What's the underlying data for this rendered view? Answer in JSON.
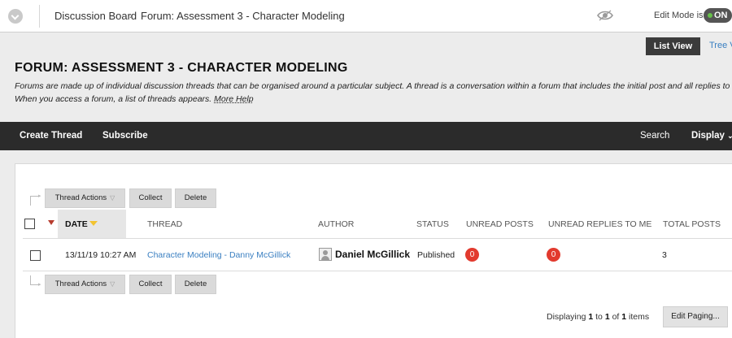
{
  "breadcrumb": {
    "items": [
      "Discussion Board",
      "Forum: Assessment 3 - Character Modeling"
    ],
    "separator": "›"
  },
  "header": {
    "edit_mode_label": "Edit Mode is:",
    "edit_mode_value": "ON"
  },
  "view_tabs": [
    "List View",
    "Tree V"
  ],
  "forum": {
    "title": "FORUM: ASSESSMENT 3 - CHARACTER MODELING",
    "description_line1": "Forums are made up of individual discussion threads that can be organised around a particular subject. A thread is a conversation within a forum that includes the initial post and all replies to it.",
    "description_line2": "When you access a forum, a list of threads appears.",
    "more_help": "More Help"
  },
  "action_bar": {
    "create_thread": "Create Thread",
    "subscribe": "Subscribe",
    "search": "Search",
    "display": "Display"
  },
  "toolbar": {
    "thread_actions": "Thread Actions",
    "collect": "Collect",
    "delete": "Delete"
  },
  "table": {
    "columns": [
      "DATE",
      "THREAD",
      "AUTHOR",
      "STATUS",
      "UNREAD POSTS",
      "UNREAD REPLIES TO ME",
      "TOTAL POSTS"
    ],
    "rows": [
      {
        "date": "13/11/19 10:27 AM",
        "thread": "Character Modeling - Danny McGillick",
        "author": "Daniel McGillick",
        "status": "Published",
        "unread_posts": "0",
        "unread_replies": "0",
        "total_posts": "3"
      }
    ]
  },
  "paging": {
    "prefix": "Displaying",
    "from": "1",
    "to_word": "to",
    "to": "1",
    "of_word": "of",
    "total": "1",
    "suffix": "items",
    "edit_paging": "Edit Paging..."
  },
  "colors": {
    "action_bar": "#2b2b2b",
    "link": "#3a7fc1",
    "badge": "#e23a2e",
    "toggle_on": "#67c04a"
  },
  "icons": [
    "menu-chevron-icon",
    "eye-icon",
    "avatar-icon",
    "flag-icon",
    "sort-triangle-icon"
  ]
}
